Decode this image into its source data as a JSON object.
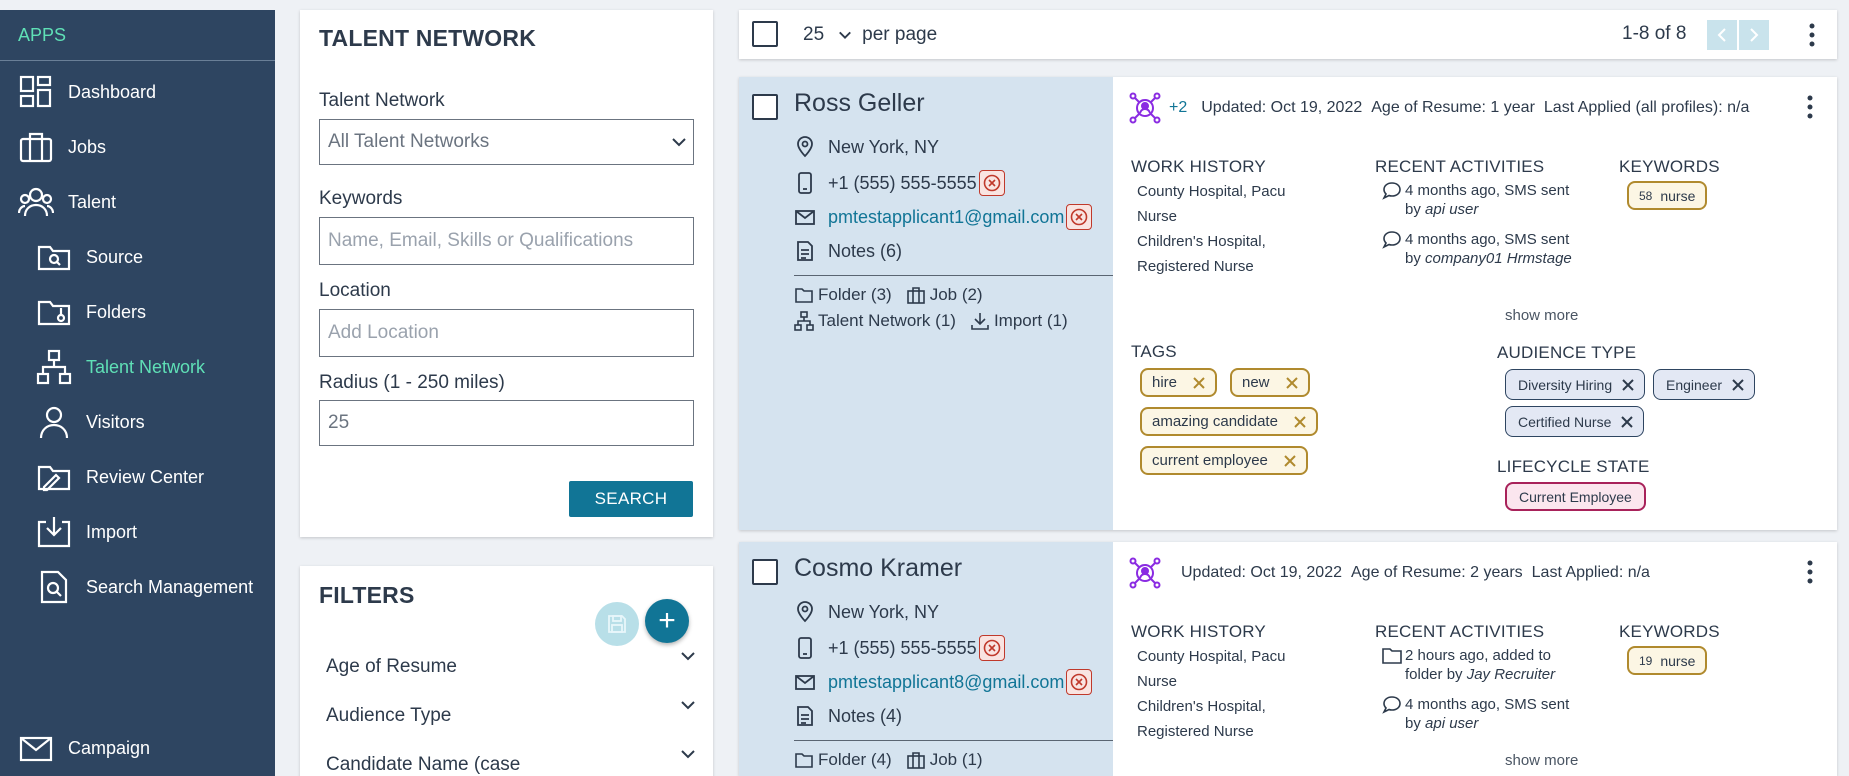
{
  "sidebar": {
    "apps_label": "APPS",
    "items": [
      {
        "label": "Dashboard",
        "icon": "dashboard-icon"
      },
      {
        "label": "Jobs",
        "icon": "briefcase-icon"
      },
      {
        "label": "Talent",
        "icon": "people-icon"
      },
      {
        "label": "Source",
        "icon": "folder-search-icon"
      },
      {
        "label": "Folders",
        "icon": "folder-icon"
      },
      {
        "label": "Talent Network",
        "icon": "network-icon",
        "active": true
      },
      {
        "label": "Visitors",
        "icon": "person-icon"
      },
      {
        "label": "Review Center",
        "icon": "review-icon"
      },
      {
        "label": "Import",
        "icon": "import-icon"
      },
      {
        "label": "Search Management",
        "icon": "search-doc-icon"
      },
      {
        "label": "Campaign",
        "icon": "mail-icon"
      }
    ]
  },
  "search_panel": {
    "title": "TALENT NETWORK",
    "network_label": "Talent Network",
    "network_value": "All Talent Networks",
    "keywords_label": "Keywords",
    "keywords_placeholder": "Name, Email, Skills or Qualifications",
    "location_label": "Location",
    "location_placeholder": "Add Location",
    "radius_label": "Radius (1 - 250 miles)",
    "radius_value": "25",
    "search_button": "SEARCH"
  },
  "filters": {
    "title": "FILTERS",
    "add_button": "+",
    "items": [
      "Age of Resume",
      "Audience Type",
      "Candidate Name (case"
    ]
  },
  "toolbar": {
    "per_page_value": "25",
    "per_page_label": "per page",
    "count": "1-8 of 8"
  },
  "candidates": [
    {
      "name": "Ross Geller",
      "location": "New York, NY",
      "phone": "+1 (555) 555-5555",
      "email": "pmtestapplicant1@gmail.com",
      "notes": "Notes (6)",
      "folder": "Folder (3)",
      "job": "Job (2)",
      "network": "Talent Network (1)",
      "import": "Import (1)",
      "plus": "+2",
      "updated": "Updated: Oct 19, 2022",
      "age": "Age of Resume: 1 year",
      "last_applied": "Last Applied (all profiles): n/a",
      "work_history_label": "WORK HISTORY",
      "work_history": [
        "County Hospital, Pacu Nurse",
        "Children's Hospital, Registered Nurse"
      ],
      "activities_label": "RECENT ACTIVITIES",
      "activities": [
        {
          "text": "4 months ago, SMS sent by",
          "by": "api user"
        },
        {
          "text": "4 months ago, SMS sent by",
          "by": "company01 Hrmstage"
        }
      ],
      "keywords_label": "KEYWORDS",
      "keyword": {
        "count": "58",
        "word": "nurse"
      },
      "show_more": "show more",
      "tags_label": "TAGS",
      "tags": [
        "hire",
        "new",
        "amazing candidate",
        "current employee"
      ],
      "audience_label": "AUDIENCE TYPE",
      "audience": [
        "Diversity Hiring",
        "Engineer",
        "Certified Nurse"
      ],
      "lifecycle_label": "LIFECYCLE STATE",
      "lifecycle": "Current Employee"
    },
    {
      "name": "Cosmo Kramer",
      "location": "New York, NY",
      "phone": "+1 (555) 555-5555",
      "email": "pmtestapplicant8@gmail.com",
      "notes": "Notes (4)",
      "folder": "Folder (4)",
      "job": "Job (1)",
      "updated": "Updated: Oct 19, 2022",
      "age": "Age of Resume: 2 years",
      "last_applied": "Last Applied: n/a",
      "work_history_label": "WORK HISTORY",
      "work_history": [
        "County Hospital, Pacu Nurse",
        "Children's Hospital, Registered Nurse"
      ],
      "activities_label": "RECENT ACTIVITIES",
      "activities": [
        {
          "text": "2 hours ago, added to folder by",
          "by": "Jay Recruiter"
        },
        {
          "text": "4 months ago, SMS sent by",
          "by": "api user"
        }
      ],
      "keywords_label": "KEYWORDS",
      "keyword": {
        "count": "19",
        "word": "nurse"
      },
      "show_more": "show more"
    }
  ],
  "colors": {
    "sidebar_bg": "#2e4561",
    "accent_green": "#5fe0b6",
    "primary_teal": "#117596",
    "card_left_bg": "#d5e3ef",
    "tag_border": "#b08a2e",
    "lifecycle_border": "#a8225a",
    "network_icon": "#8a2be2"
  }
}
